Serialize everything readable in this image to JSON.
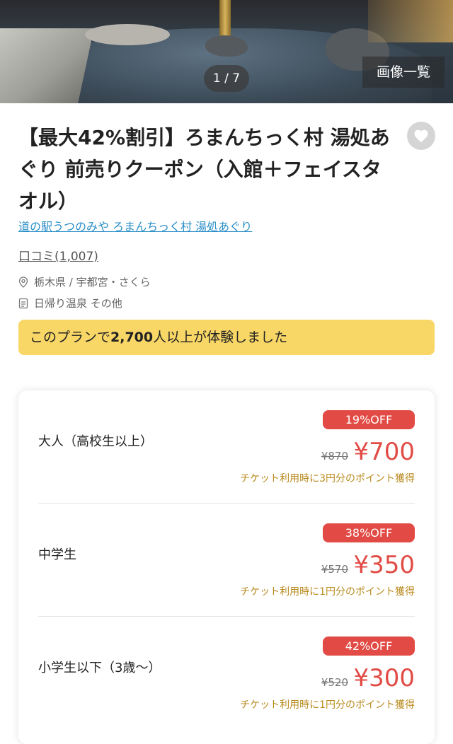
{
  "hero": {
    "pager": "1 / 7",
    "gallery_button": "画像一覧"
  },
  "title": "【最大42%割引】ろまんちっく村 湯処あぐり 前売りクーポン（入館＋フェイスタオル）",
  "facility_link": "道の駅うつのみや ろまんちっく村 湯処あぐり",
  "reviews": "口コミ(1,007)",
  "location": "栃木県 / 宇都宮・さくら",
  "category": "日帰り温泉 その他",
  "banner": {
    "prefix": "このプランで",
    "count": "2,700",
    "suffix": "人以上が体験しました"
  },
  "prices": [
    {
      "label": "大人（高校生以上）",
      "discount": "19%OFF",
      "old_price": "¥870",
      "price": "¥700",
      "points": "チケット利用時に3円分のポイント獲得"
    },
    {
      "label": "中学生",
      "discount": "38%OFF",
      "old_price": "¥570",
      "price": "¥350",
      "points": "チケット利用時に1円分のポイント獲得"
    },
    {
      "label": "小学生以下（3歳〜）",
      "discount": "42%OFF",
      "old_price": "¥520",
      "price": "¥300",
      "points": "チケット利用時に1円分のポイント獲得"
    }
  ],
  "colors": {
    "accent_red": "#e24b45",
    "banner_yellow": "#f8d767",
    "link_blue": "#2b8fc8",
    "points_gold": "#b98a1e"
  },
  "icons": [
    "heart-icon",
    "location-pin-icon",
    "category-tag-icon"
  ]
}
